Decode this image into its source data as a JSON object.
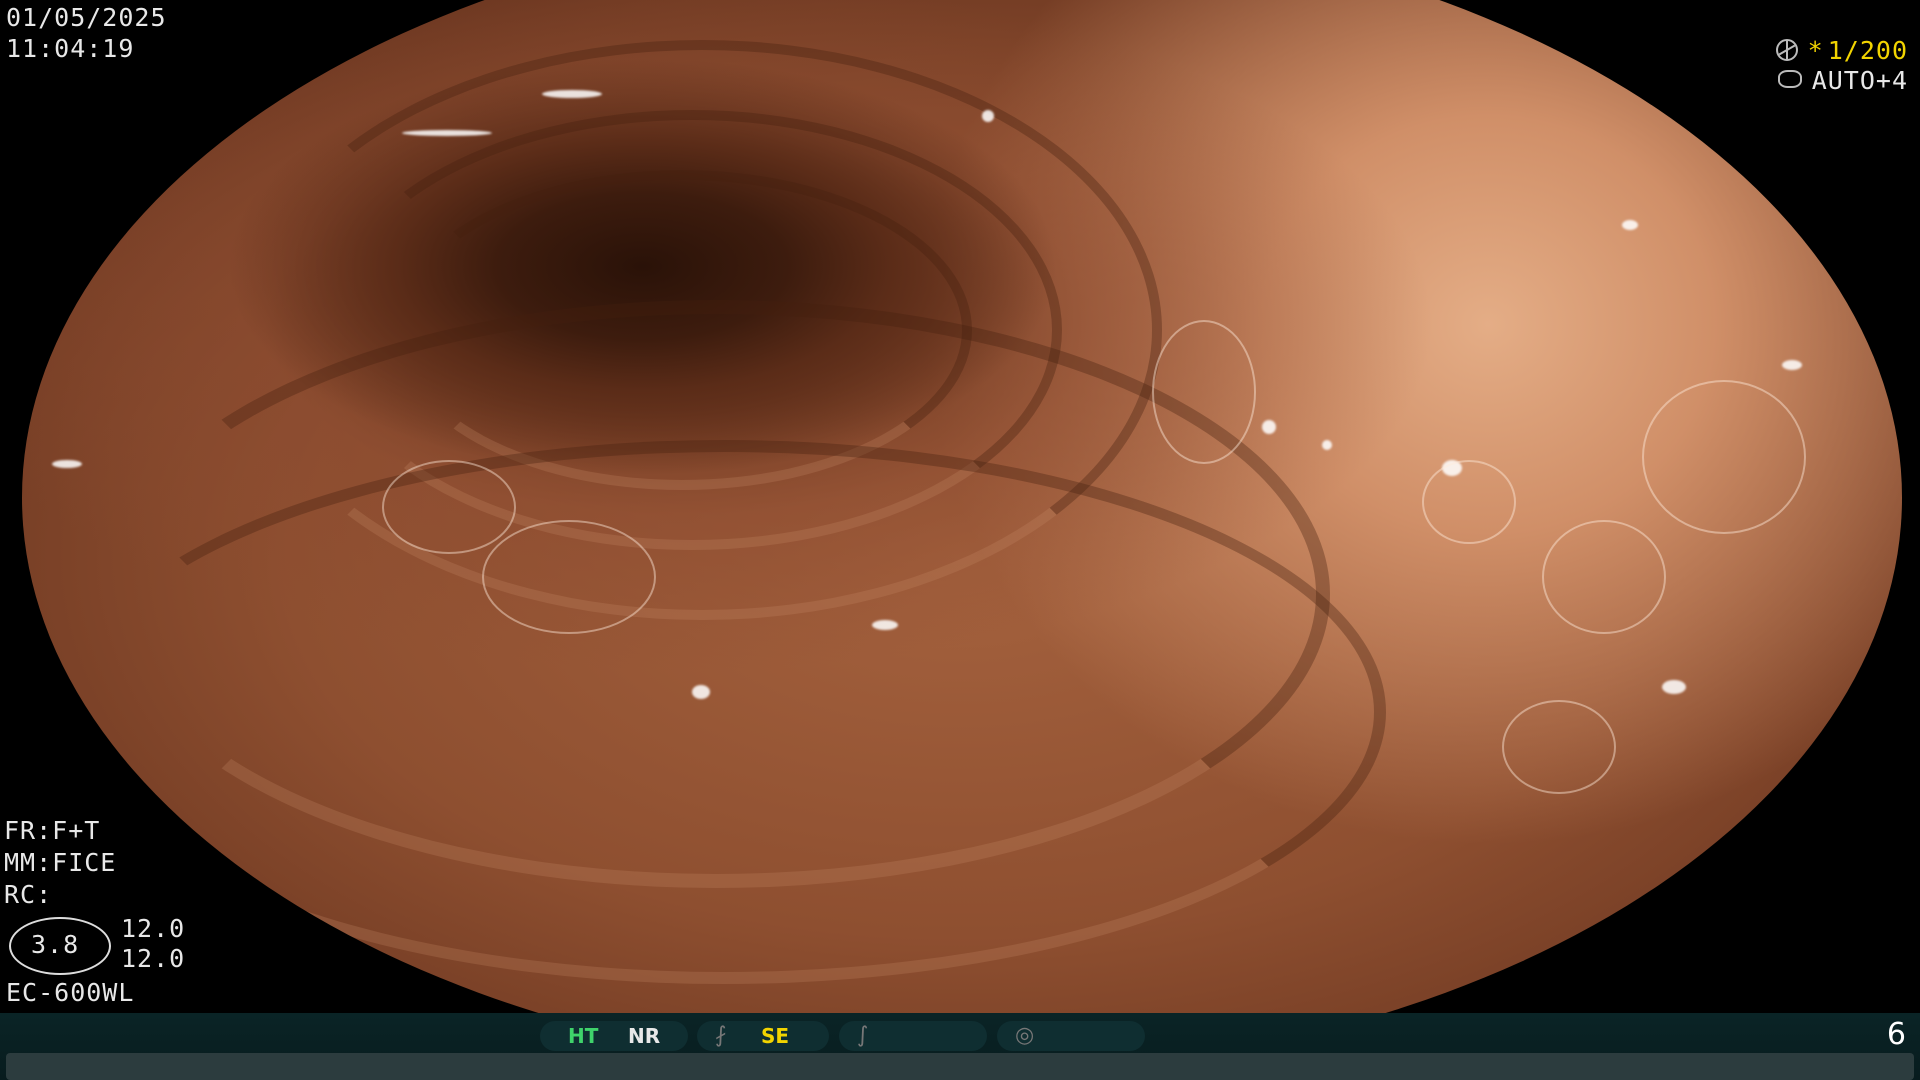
{
  "header": {
    "date": "01/05/2025",
    "time": "11:04:19"
  },
  "camera": {
    "shutter_star": "*",
    "shutter": "1/200",
    "exposure": "AUTO+4",
    "shutter_icon": "aperture-icon",
    "exposure_icon": "iris-icon"
  },
  "settings": {
    "fr": "FR:F+T",
    "mm": "MM:FICE",
    "rc": "RC:",
    "ratio": "3.8",
    "value_a": "12.0",
    "value_b": "12.0",
    "scope_model": "EC-600WL"
  },
  "status_bar": {
    "ht": "HT",
    "nr": "NR",
    "se": "SE",
    "page": "6",
    "colors": {
      "ht": "#3fd36b",
      "se": "#f2d400"
    }
  }
}
